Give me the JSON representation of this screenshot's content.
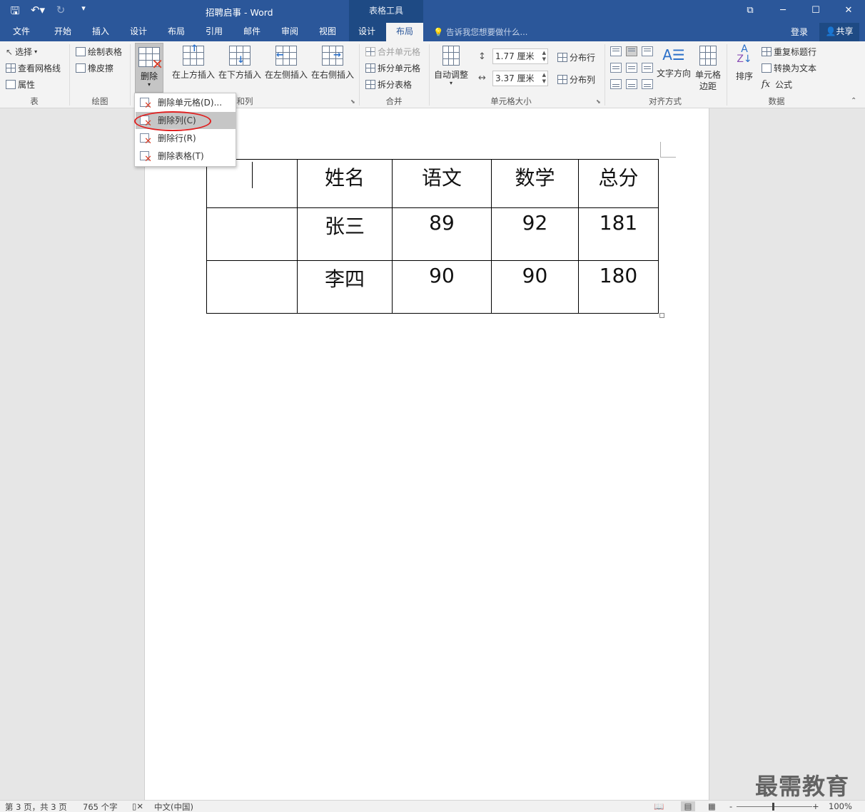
{
  "titlebar": {
    "title": "招聘启事 - Word",
    "context_tab_group": "表格工具",
    "save_icon": "save-icon",
    "undo_icon": "undo-icon",
    "redo_icon": "redo-icon",
    "customize_icon": "qat-dropdown-icon",
    "restore_glyph": "⧉",
    "minimize_glyph": "─",
    "maximize_glyph": "☐",
    "close_glyph": "✕"
  },
  "tabs": {
    "items": [
      "文件",
      "开始",
      "插入",
      "设计",
      "布局",
      "引用",
      "邮件",
      "审阅",
      "视图",
      "设计",
      "布局"
    ],
    "active_index": 10,
    "tell_me": "告诉我您想要做什么...",
    "login": "登录",
    "share": "共享"
  },
  "ribbon": {
    "table": {
      "label": "表",
      "select": "选择",
      "view_gridlines": "查看网格线",
      "properties": "属性"
    },
    "draw": {
      "label": "绘图",
      "draw_table": "绘制表格",
      "eraser": "橡皮擦"
    },
    "rows_cols": {
      "label": "和列",
      "delete": "删除",
      "insert_above": "在上方插入",
      "insert_below": "在下方插入",
      "insert_left": "在左侧插入",
      "insert_right": "在右侧插入"
    },
    "merge": {
      "label": "合并",
      "merge_cells": "合并单元格",
      "split_cells": "拆分单元格",
      "split_table": "拆分表格"
    },
    "cell_size": {
      "label": "单元格大小",
      "autofit": "自动调整",
      "height": "1.77 厘米",
      "width": "3.37 厘米",
      "distribute_rows": "分布行",
      "distribute_cols": "分布列"
    },
    "alignment": {
      "label": "对齐方式",
      "text_direction": "文字方向",
      "cell_margins_1": "单元格",
      "cell_margins_2": "边距"
    },
    "data": {
      "label": "数据",
      "sort": "排序",
      "repeat_header": "重复标题行",
      "convert_to_text": "转换为文本",
      "formula": "公式",
      "formula_glyph": "fx"
    }
  },
  "delete_menu": {
    "items": [
      "删除单元格(D)...",
      "删除列(C)",
      "删除行(R)",
      "删除表格(T)"
    ],
    "highlighted_index": 1
  },
  "document": {
    "table": {
      "rows": [
        [
          "",
          "姓名",
          "语文",
          "数学",
          "总分"
        ],
        [
          "",
          "张三",
          "89",
          "92",
          "181"
        ],
        [
          "",
          "李四",
          "90",
          "90",
          "180"
        ]
      ]
    }
  },
  "statusbar": {
    "page": "第 3 页，共 3 页",
    "words": "765 个字",
    "language": "中文(中国)",
    "zoom": "100%",
    "zoom_minus": "-",
    "zoom_plus": "+"
  },
  "watermark": "最需教育",
  "colors": {
    "accent": "#2b579a",
    "context": "#1e4a84",
    "highlight_ellipse": "#e02020"
  }
}
